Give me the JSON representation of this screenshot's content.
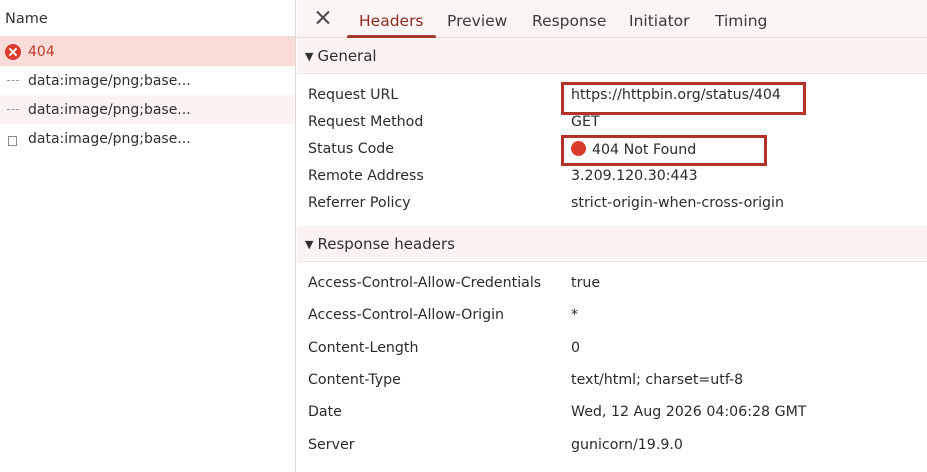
{
  "request_list": {
    "column_header": "Name",
    "requests": [
      {
        "name": "404",
        "icon": "error-icon"
      },
      {
        "name": "data:image/png;base...",
        "icon": "dash-icon"
      },
      {
        "name": "data:image/png;base...",
        "icon": "dash-icon"
      },
      {
        "name": "data:image/png;base...",
        "icon": "file-icon"
      }
    ]
  },
  "tabs": {
    "close_icon": "close-icon",
    "items": [
      "Headers",
      "Preview",
      "Response",
      "Initiator",
      "Timing"
    ],
    "active": "Headers"
  },
  "general": {
    "title": "General",
    "rows": [
      {
        "key": "Request URL",
        "value": "https://httpbin.org/status/404"
      },
      {
        "key": "Request Method",
        "value": "GET"
      },
      {
        "key": "Status Code",
        "value": "404 Not Found"
      },
      {
        "key": "Remote Address",
        "value": "3.209.120.30:443"
      },
      {
        "key": "Referrer Policy",
        "value": "strict-origin-when-cross-origin"
      }
    ]
  },
  "response_headers": {
    "title": "Response headers",
    "rows": [
      {
        "key": "Access-Control-Allow-Credentials",
        "value": "true"
      },
      {
        "key": "Access-Control-Allow-Origin",
        "value": "*"
      },
      {
        "key": "Content-Length",
        "value": "0"
      },
      {
        "key": "Content-Type",
        "value": "text/html; charset=utf-8"
      },
      {
        "key": "Date",
        "value": "Wed, 12 Aug 2026 04:06:28 GMT"
      },
      {
        "key": "Server",
        "value": "gunicorn/19.9.0"
      }
    ]
  },
  "colors": {
    "error": "#d93a2b",
    "active_tab": "#8e2b24",
    "highlight_border": "#b3332b",
    "selected_row": "#f9dcd8"
  }
}
